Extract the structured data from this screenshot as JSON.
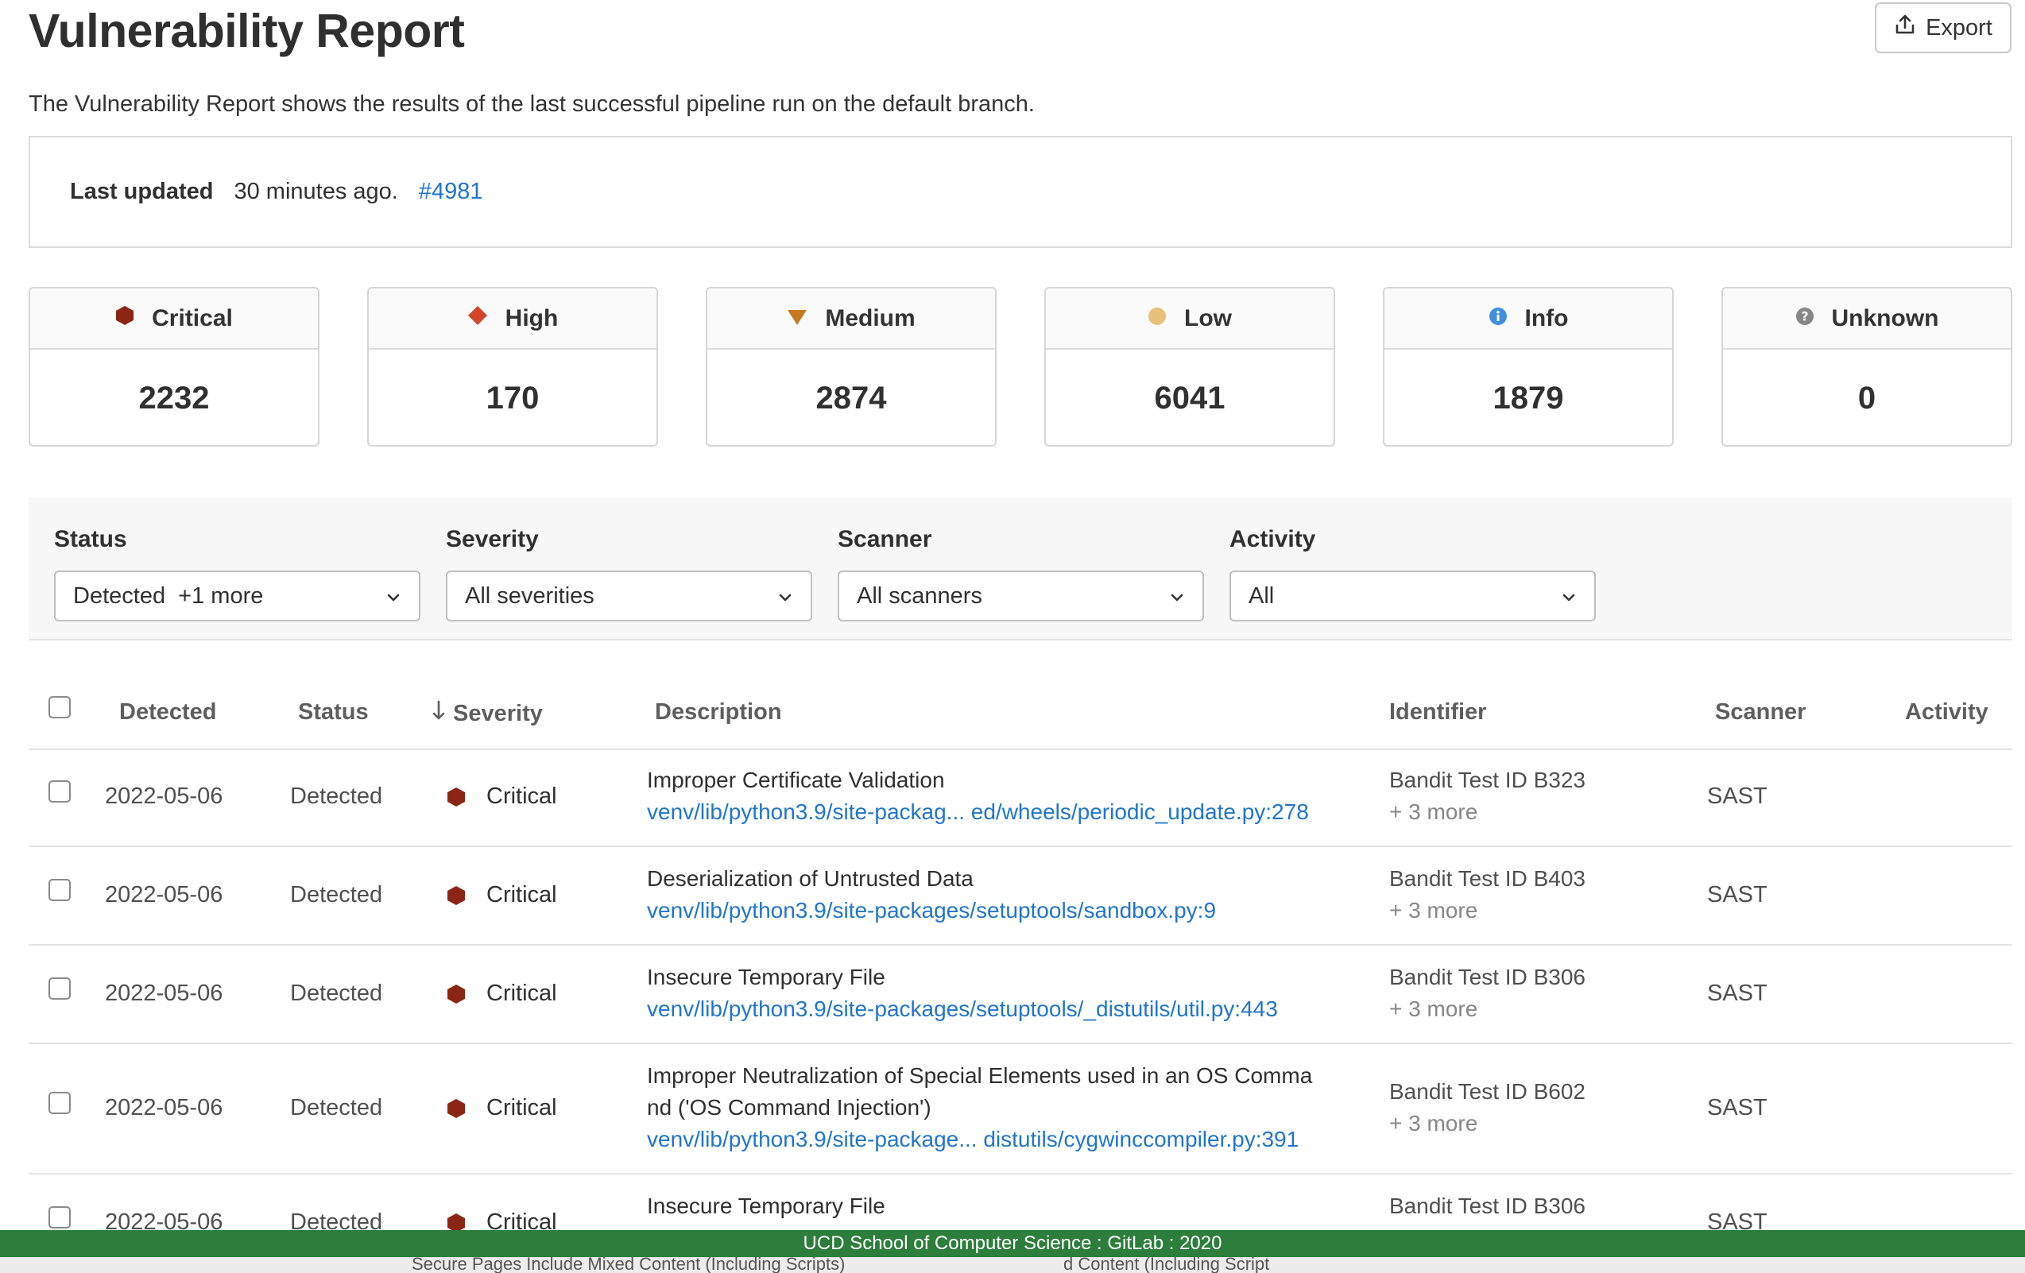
{
  "header": {
    "title": "Vulnerability Report",
    "export_label": "Export",
    "subtitle": "The Vulnerability Report shows the results of the last successful pipeline run on the default branch."
  },
  "last_updated": {
    "label": "Last updated",
    "time": "30 minutes ago.",
    "pipeline": "#4981"
  },
  "severity_counts": [
    {
      "label": "Critical",
      "count": "2232",
      "icon": "critical-icon",
      "color": "#8b2615"
    },
    {
      "label": "High",
      "count": "170",
      "icon": "high-icon",
      "color": "#d4462c"
    },
    {
      "label": "Medium",
      "count": "2874",
      "icon": "medium-icon",
      "color": "#c57a22"
    },
    {
      "label": "Low",
      "count": "6041",
      "icon": "low-icon",
      "color": "#e8c07a"
    },
    {
      "label": "Info",
      "count": "1879",
      "icon": "info-icon",
      "color": "#428fdc"
    },
    {
      "label": "Unknown",
      "count": "0",
      "icon": "unknown-icon",
      "color": "#868686"
    }
  ],
  "filters": {
    "status": {
      "label": "Status",
      "value": "Detected  +1 more"
    },
    "severity": {
      "label": "Severity",
      "value": "All severities"
    },
    "scanner": {
      "label": "Scanner",
      "value": "All scanners"
    },
    "activity": {
      "label": "Activity",
      "value": "All"
    }
  },
  "table": {
    "columns": {
      "detected": "Detected",
      "status": "Status",
      "severity": "Severity",
      "description": "Description",
      "identifier": "Identifier",
      "scanner": "Scanner",
      "activity": "Activity"
    },
    "rows": [
      {
        "detected": "2022-05-06",
        "status": "Detected",
        "severity": "Critical",
        "title": "Improper Certificate Validation",
        "title2": "",
        "location": "venv/lib/python3.9/site-packag... ed/wheels/periodic_update.py:278",
        "identifier": "Bandit Test ID B323",
        "more": "+ 3 more",
        "scanner": "SAST"
      },
      {
        "detected": "2022-05-06",
        "status": "Detected",
        "severity": "Critical",
        "title": "Deserialization of Untrusted Data",
        "title2": "",
        "location": "venv/lib/python3.9/site-packages/setuptools/sandbox.py:9",
        "identifier": "Bandit Test ID B403",
        "more": "+ 3 more",
        "scanner": "SAST"
      },
      {
        "detected": "2022-05-06",
        "status": "Detected",
        "severity": "Critical",
        "title": "Insecure Temporary File",
        "title2": "",
        "location": "venv/lib/python3.9/site-packages/setuptools/_distutils/util.py:443",
        "identifier": "Bandit Test ID B306",
        "more": "+ 3 more",
        "scanner": "SAST"
      },
      {
        "detected": "2022-05-06",
        "status": "Detected",
        "severity": "Critical",
        "title": "Improper Neutralization of Special Elements used in an OS Comma",
        "title2": "nd ('OS Command Injection')",
        "location": "venv/lib/python3.9/site-package...  distutils/cygwinccompiler.py:391",
        "identifier": "Bandit Test ID B602",
        "more": "+ 3 more",
        "scanner": "SAST"
      },
      {
        "detected": "2022-05-06",
        "status": "Detected",
        "severity": "Critical",
        "title": "Insecure Temporary File",
        "title2": "",
        "location": "",
        "identifier": "Bandit Test ID B306",
        "more": "",
        "scanner": "SAST"
      }
    ]
  },
  "footer": {
    "banner": "UCD School of Computer Science : GitLab : 2020",
    "underlay_left": "Secure Pages Include Mixed Content (Including Scripts)",
    "underlay_right": "d Content (Including Script"
  }
}
